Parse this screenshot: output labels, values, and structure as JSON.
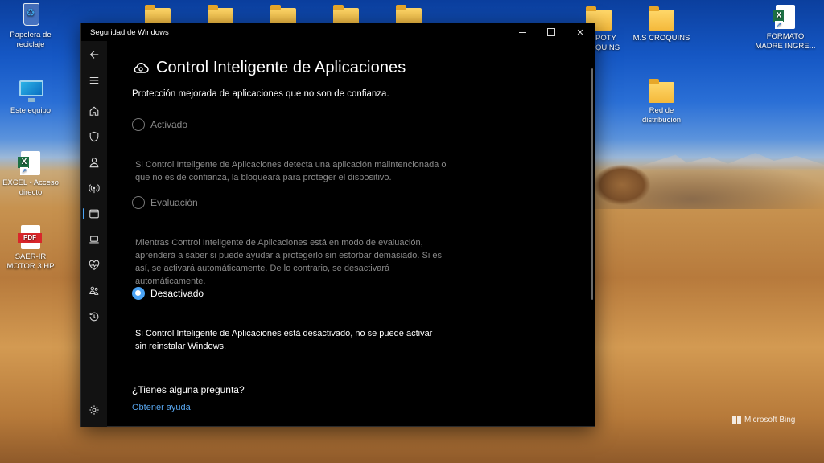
{
  "desktop": {
    "icons": [
      {
        "label": "Papelera de reciclaje",
        "kind": "recycle-bin"
      },
      {
        "label": "Este equipo",
        "kind": "computer"
      },
      {
        "label": "EXCEL - Acceso directo",
        "kind": "excel-shortcut"
      },
      {
        "label": "SAER-IR MOTOR 3 HP",
        "kind": "pdf"
      },
      {
        "label": "POTY QUINS",
        "kind": "folder"
      },
      {
        "label": "M.S CROQUINS",
        "kind": "folder"
      },
      {
        "label": "FORMATO MADRE INGRE...",
        "kind": "excel"
      },
      {
        "label": "Red de distribucion",
        "kind": "folder"
      }
    ],
    "watermark": "Microsoft Bing"
  },
  "window": {
    "title": "Seguridad de Windows",
    "controls": {
      "minimize": "",
      "maximize": "",
      "close": "✕"
    }
  },
  "page": {
    "title": "Control Inteligente de Aplicaciones",
    "subtitle": "Protección mejorada de aplicaciones que no son de confianza.",
    "options": [
      {
        "label": "Activado",
        "selected": false,
        "description": "Si Control Inteligente de Aplicaciones detecta una aplicación malintencionada o que no es de confianza, la bloqueará para proteger el dispositivo."
      },
      {
        "label": "Evaluación",
        "selected": false,
        "description": "Mientras Control Inteligente de Aplicaciones está en modo de evaluación, aprenderá a saber si puede ayudar a protegerlo sin estorbar demasiado. Si es así, se activará automáticamente. De lo contrario, se desactivará automáticamente."
      },
      {
        "label": "Desactivado",
        "selected": true,
        "description": "Si Control Inteligente de Aplicaciones está desactivado, no se puede activar sin reinstalar Windows."
      }
    ],
    "question": "¿Tienes alguna pregunta?",
    "help_link": "Obtener ayuda"
  },
  "nav": {
    "items": [
      "back-icon",
      "menu-icon",
      "home-icon",
      "shield-icon",
      "person-icon",
      "wifi-icon",
      "app-browser-icon",
      "laptop-icon",
      "health-icon",
      "family-icon",
      "history-icon",
      "gear-icon"
    ],
    "active": "app-browser-icon"
  },
  "colors": {
    "accent": "#4aa3f5",
    "link": "#58a6ee",
    "dim_text": "#8a8a8a",
    "window_bg": "#000000",
    "nav_bg": "#121212"
  }
}
